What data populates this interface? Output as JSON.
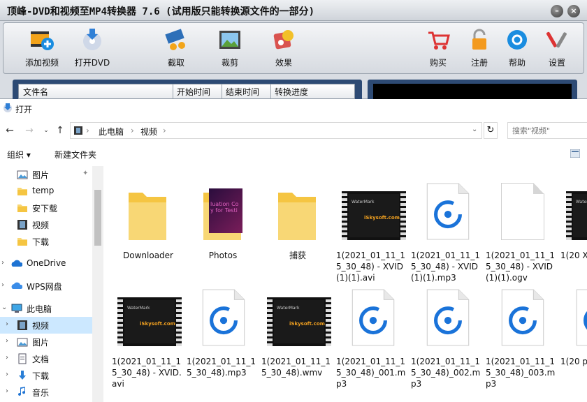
{
  "app": {
    "title": "顶峰-DVD和视频至MP4转换器 7.6 (试用版只能转换源文件的一部分)",
    "toolbar": {
      "add_video": "添加视频",
      "open_dvd": "打开DVD",
      "capture": "截取",
      "crop": "裁剪",
      "effect": "效果",
      "buy": "购买",
      "register": "注册",
      "help": "帮助",
      "settings": "设置"
    },
    "columns": [
      "文件名",
      "开始时间",
      "结束时间",
      "转换进度"
    ]
  },
  "dialog": {
    "title": "打开",
    "breadcrumb": [
      "此电脑",
      "视频"
    ],
    "search_placeholder": "搜索\"视频\"",
    "commands": {
      "organize": "组织 ▾",
      "new_folder": "新建文件夹"
    },
    "nav": [
      {
        "label": "图片",
        "icon": "pictures-icon",
        "indent": 1,
        "pinned": true
      },
      {
        "label": "temp",
        "icon": "folder-icon",
        "indent": 1
      },
      {
        "label": "安下载",
        "icon": "folder-icon",
        "indent": 1
      },
      {
        "label": "视频",
        "icon": "videos-icon",
        "indent": 1
      },
      {
        "label": "下载",
        "icon": "folder-icon",
        "indent": 1
      },
      {
        "label": "OneDrive",
        "icon": "onedrive-icon",
        "indent": 0,
        "chevron": ">"
      },
      {
        "label": "WPS网盘",
        "icon": "wps-cloud-icon",
        "indent": 0,
        "chevron": ">"
      },
      {
        "label": "此电脑",
        "icon": "computer-icon",
        "indent": 0,
        "chevron": "v"
      },
      {
        "label": "视频",
        "icon": "videos-icon",
        "indent": 1,
        "chevron": ">",
        "selected": true
      },
      {
        "label": "图片",
        "icon": "pictures-icon",
        "indent": 1,
        "chevron": ">"
      },
      {
        "label": "文档",
        "icon": "documents-icon",
        "indent": 1,
        "chevron": ">"
      },
      {
        "label": "下载",
        "icon": "download-icon",
        "indent": 1,
        "chevron": ">"
      },
      {
        "label": "音乐",
        "icon": "music-icon",
        "indent": 1,
        "chevron": ">"
      }
    ],
    "files": [
      {
        "name": "Downloader",
        "kind": "folder"
      },
      {
        "name": "Photos",
        "kind": "folder-photo"
      },
      {
        "name": "捕获",
        "kind": "folder"
      },
      {
        "name": "1(2021_01_11_15_30_48) - XVID(1)(1).avi",
        "kind": "video"
      },
      {
        "name": "1(2021_01_11_15_30_48) - XVID(1)(1).mp3",
        "kind": "audio"
      },
      {
        "name": "1(2021_01_11_15_30_48) - XVID(1)(1).ogv",
        "kind": "blank"
      },
      {
        "name": "1(20 XVI",
        "kind": "video"
      },
      {
        "name": "1(2021_01_11_15_30_48) - XVID.avi",
        "kind": "video"
      },
      {
        "name": "1(2021_01_11_15_30_48).mp3",
        "kind": "audio"
      },
      {
        "name": "1(2021_01_11_15_30_48).wmv",
        "kind": "video"
      },
      {
        "name": "1(2021_01_11_15_30_48)_001.mp3",
        "kind": "audio"
      },
      {
        "name": "1(2021_01_11_15_30_48)_002.mp3",
        "kind": "audio"
      },
      {
        "name": "1(2021_01_11_15_30_48)_003.mp3",
        "kind": "audio"
      },
      {
        "name": "1(20 p3",
        "kind": "audio"
      }
    ],
    "thumb_text": {
      "watermark": "WaterMark",
      "logo": "iSkysoft.com",
      "photo_text": "luation Co y for Testi"
    }
  },
  "colors": {
    "selected_nav": "#cce8ff",
    "audio_blue": "#1a73d9",
    "folder_yellow": "#f8d775"
  }
}
